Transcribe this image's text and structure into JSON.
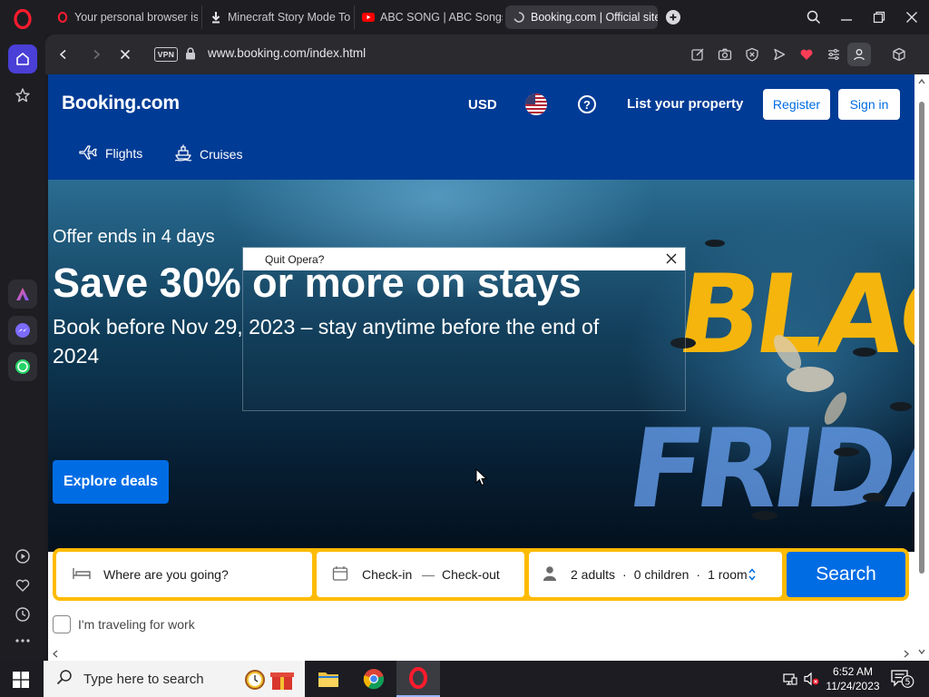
{
  "browser": {
    "tabs": [
      {
        "title": "Your personal browser is a",
        "icon": "opera-icon"
      },
      {
        "title": "Minecraft Story Mode Tor",
        "icon": "download-icon"
      },
      {
        "title": "ABC SONG | ABC Songs fo",
        "icon": "youtube-icon"
      },
      {
        "title": "Booking.com | Official site",
        "icon": "loading-icon",
        "active": true
      }
    ],
    "vpn_label": "VPN",
    "url": "www.booking.com/index.html"
  },
  "site": {
    "logo": "Booking.com",
    "currency": "USD",
    "help": "?",
    "list_property": "List your property",
    "register": "Register",
    "sign_in": "Sign in",
    "nav": [
      {
        "label": "Flights",
        "icon": "plane-icon"
      },
      {
        "label": "Cruises",
        "icon": "ship-icon"
      }
    ],
    "hero": {
      "offer": "Offer ends in 4 days",
      "headline": "Save 30% or more on stays",
      "subline": "Book before Nov 29, 2023 – stay anytime before the end of 2024",
      "cta": "Explore deals",
      "banner_text": [
        "BLAC",
        "FRIDA"
      ]
    },
    "search": {
      "destination_placeholder": "Where are you going?",
      "check_in": "Check-in",
      "dash": "—",
      "check_out": "Check-out",
      "adults": "2 adults",
      "children": "0 children",
      "rooms": "1 room",
      "sep": "·",
      "button": "Search"
    },
    "work_travel": "I'm traveling for work"
  },
  "dialog": {
    "title": "Quit Opera?"
  },
  "taskbar": {
    "search_placeholder": "Type here to search",
    "time": "6:52 AM",
    "date": "11/24/2023",
    "notifications": "5"
  },
  "colors": {
    "booking_blue": "#003b95",
    "action_blue": "#006ce4",
    "search_yellow": "#febb02",
    "opera_red": "#ff1b2d"
  }
}
